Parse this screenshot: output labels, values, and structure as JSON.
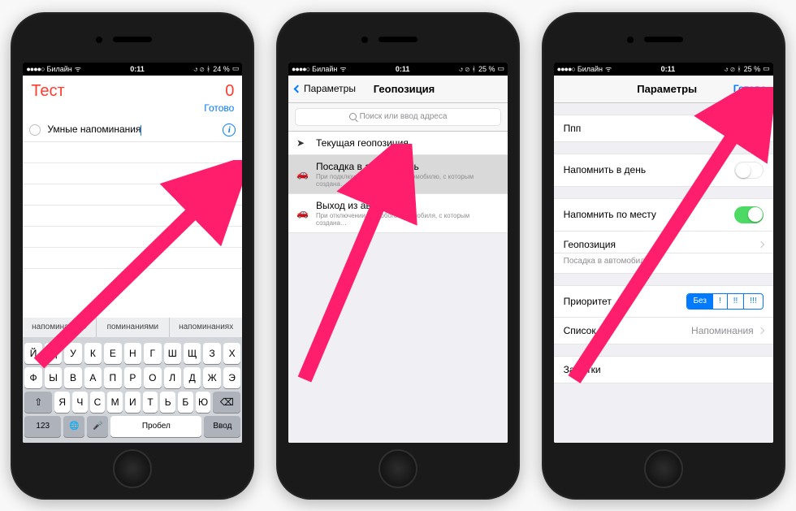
{
  "status": {
    "carrier": "Билайн",
    "time": "0:11",
    "battery1": "24 %",
    "battery2": "25 %",
    "battery3": "25 %"
  },
  "phone1": {
    "list_title": "Тест",
    "count": "0",
    "done": "Готово",
    "reminder_text": "Умные напоминания",
    "keyboard": {
      "suggestions": [
        "напоминания»",
        "поминаниями",
        "напоминаниях"
      ],
      "row1": [
        "Й",
        "Ц",
        "У",
        "К",
        "Е",
        "Н",
        "Г",
        "Ш",
        "Щ",
        "З",
        "Х"
      ],
      "row2": [
        "Ф",
        "Ы",
        "В",
        "А",
        "П",
        "Р",
        "О",
        "Л",
        "Д",
        "Ж",
        "Э"
      ],
      "row3": [
        "Я",
        "Ч",
        "С",
        "М",
        "И",
        "Т",
        "Ь",
        "Б",
        "Ю"
      ],
      "num_key": "123",
      "space": "Пробел",
      "return": "Ввод"
    }
  },
  "phone2": {
    "back": "Параметры",
    "title": "Геопозиция",
    "search_placeholder": "Поиск или ввод адреса",
    "items": [
      {
        "icon": "➤",
        "title": "Текущая геопозиция",
        "sub": ""
      },
      {
        "icon": "🚗",
        "title": "Посадка в автомобиль",
        "sub": "При подключении к любому автомобилю, с которым создана…"
      },
      {
        "icon": "🚗",
        "title": "Выход из автомобиля",
        "sub": "При отключении от любого автомобиля, с которым создана…"
      }
    ]
  },
  "phone3": {
    "title": "Параметры",
    "done": "Готово",
    "reminder_title": "Ппп",
    "row_day": "Напомнить в день",
    "row_place": "Напомнить по месту",
    "row_geo": "Геопозиция",
    "row_geo_sub": "Посадка в автомобиль",
    "row_priority": "Приоритет",
    "priority_options": [
      "Без",
      "!",
      "!!",
      "!!!"
    ],
    "priority_active": 0,
    "row_list": "Список",
    "row_list_value": "Напоминания",
    "row_notes": "Заметки"
  }
}
